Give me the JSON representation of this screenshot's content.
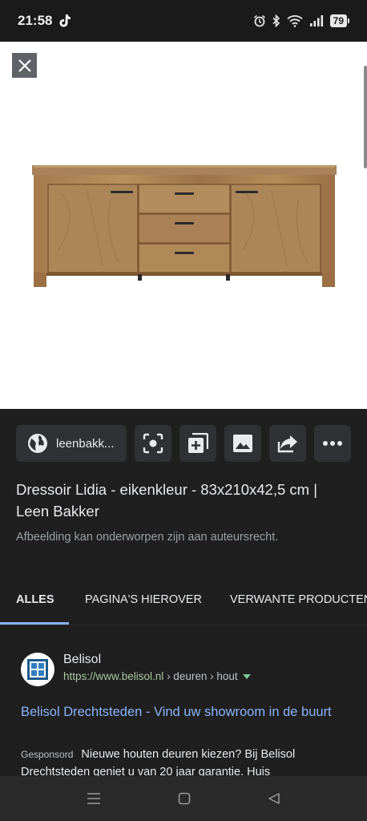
{
  "status_bar": {
    "time": "21:58",
    "battery": "79",
    "icons": [
      "tiktok-icon",
      "alarm-icon",
      "bluetooth-icon",
      "wifi-icon",
      "signal-icon",
      "battery-icon"
    ]
  },
  "viewer": {
    "close_icon": "close-icon",
    "image_subject": "oak-sideboard"
  },
  "actions": {
    "site_label": "leenbakk...",
    "icons": [
      "globe-icon",
      "lens-icon",
      "add-collection-icon",
      "image-icon",
      "share-icon",
      "more-icon"
    ]
  },
  "result_info": {
    "title": "Dressoir Lidia - eikenkleur - 83x210x42,5 cm | Leen Bakker",
    "copyright_note": "Afbeelding kan onderworpen zijn aan auteursrecht."
  },
  "tabs": [
    {
      "label": "ALLES",
      "active": true
    },
    {
      "label": "PAGINA'S HIEROVER",
      "active": false
    },
    {
      "label": "VERWANTE PRODUCTEN",
      "active": false
    }
  ],
  "ad": {
    "site_name": "Belisol",
    "url_domain": "https://www.belisol.nl",
    "url_path": " › deuren › hout",
    "title": "Belisol Drechtsteden - Vind uw showroom in de buurt",
    "sponsored_label": "Gesponsord",
    "description": "Nieuwe houten deuren kiezen? Bij Belisol Drechtsteden geniet u van 20 jaar garantie. Huis"
  },
  "colors": {
    "background": "#1f1f1f",
    "chip": "#303134",
    "link": "#8ab4f8",
    "accent_tab": "#8ab4f8",
    "url_green": "#a8c7a0"
  }
}
